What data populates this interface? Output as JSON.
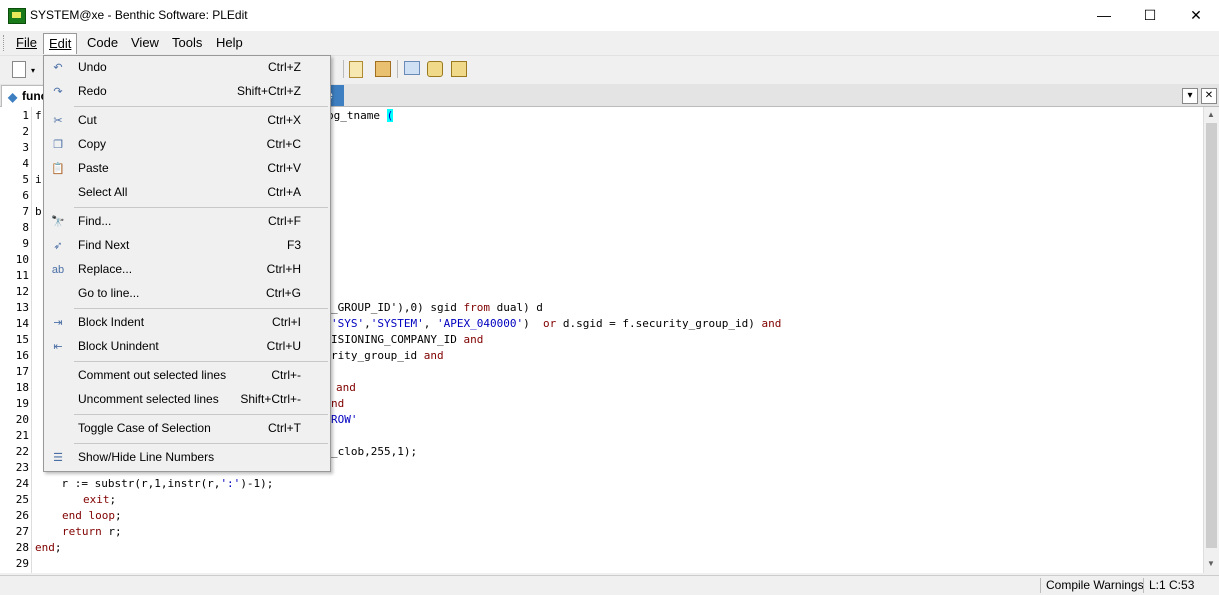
{
  "window": {
    "title": "SYSTEM@xe - Benthic Software: PLEdit",
    "minimize": "—",
    "maximize": "☐",
    "close": "✕"
  },
  "menubar": {
    "items": [
      {
        "label": "File"
      },
      {
        "label": "Edit"
      },
      {
        "label": "Code"
      },
      {
        "label": "View"
      },
      {
        "label": "Tools"
      },
      {
        "label": "Help"
      }
    ]
  },
  "tabs": {
    "left_label": "func",
    "right_label": "e",
    "dropdown_glyph": "▾",
    "close_glyph": "✕"
  },
  "edit_menu": {
    "items": [
      {
        "label": "Undo",
        "shortcut": "Ctrl+Z",
        "icon": "undo-icon",
        "glyph": "↶"
      },
      {
        "label": "Redo",
        "shortcut": "Shift+Ctrl+Z",
        "icon": "redo-icon",
        "glyph": "↷"
      },
      {
        "label": "Cut",
        "shortcut": "Ctrl+X",
        "icon": "scissors-icon",
        "glyph": "✂"
      },
      {
        "label": "Copy",
        "shortcut": "Ctrl+C",
        "icon": "copy-icon",
        "glyph": "❐"
      },
      {
        "label": "Paste",
        "shortcut": "Ctrl+V",
        "icon": "paste-icon",
        "glyph": "📋"
      },
      {
        "label": "Select All",
        "shortcut": "Ctrl+A",
        "icon": "",
        "glyph": ""
      },
      {
        "label": "Find...",
        "shortcut": "Ctrl+F",
        "icon": "binoculars-icon",
        "glyph": "🔭"
      },
      {
        "label": "Find Next",
        "shortcut": "F3",
        "icon": "find-next-icon",
        "glyph": "➶"
      },
      {
        "label": "Replace...",
        "shortcut": "Ctrl+H",
        "icon": "replace-icon",
        "glyph": "ab"
      },
      {
        "label": "Go to line...",
        "shortcut": "Ctrl+G",
        "icon": "",
        "glyph": ""
      },
      {
        "label": "Block Indent",
        "shortcut": "Ctrl+I",
        "icon": "indent-icon",
        "glyph": "⇥"
      },
      {
        "label": "Block Unindent",
        "shortcut": "Ctrl+U",
        "icon": "unindent-icon",
        "glyph": "⇤"
      },
      {
        "label": "Comment out selected lines",
        "shortcut": "Ctrl+-",
        "icon": "",
        "glyph": ""
      },
      {
        "label": "Uncomment selected lines",
        "shortcut": "Shift+Ctrl+-",
        "icon": "",
        "glyph": ""
      },
      {
        "label": "Toggle Case of Selection",
        "shortcut": "Ctrl+T",
        "icon": "",
        "glyph": ""
      },
      {
        "label": "Show/Hide Line Numbers",
        "shortcut": "",
        "icon": "line-numbers-icon",
        "glyph": "☰"
      }
    ]
  },
  "code": {
    "line_numbers": [
      "1",
      "2",
      "3",
      "4",
      "5",
      "6",
      "7",
      "8",
      "9",
      "10",
      "11",
      "12",
      "13",
      "14",
      "15",
      "16",
      "17",
      "18",
      "19",
      "20",
      "21",
      "22",
      "23",
      "24",
      "25",
      "26",
      "27",
      "28",
      "29"
    ],
    "line1_prefix": "f",
    "line1_tail": "pg_tname ",
    "line1_paren": "(",
    "line5": "i",
    "line7": "b",
    "line13_a": "_GROUP_ID'),0) sgid ",
    "line13_kw": "from",
    "line13_b": " dual) d",
    "line14_s1": "'SYS'",
    "line14_c1": ",",
    "line14_s2": "'SYSTEM'",
    "line14_c2": ", ",
    "line14_s3": "'APEX_040000'",
    "line14_a": ")  ",
    "line14_kw1": "or",
    "line14_b": " d.sgid = f.security_group_id) ",
    "line14_kw2": "and",
    "line15_a": "ISIONING_COMPANY_ID ",
    "line15_kw": "and",
    "line16_a": "rity_group_id ",
    "line16_kw": "and",
    "line18_kw": "and",
    "line19_kw": "nd",
    "line20_s": "ROW'",
    "line22_a": "_clob,255,1);",
    "line24_a": "    r := substr(r,1,instr(r,",
    "line24_s": "':'",
    "line24_b": ")-1);",
    "line25_kw": "exit",
    "line25_b": ";",
    "line26_kw": "end loop",
    "line26_b": ";",
    "line27_kw": "return",
    "line27_b": " r;",
    "line28_kw": "end",
    "line28_b": ";"
  },
  "status": {
    "compile_warnings": "Compile Warnings",
    "position": "L:1 C:53"
  }
}
